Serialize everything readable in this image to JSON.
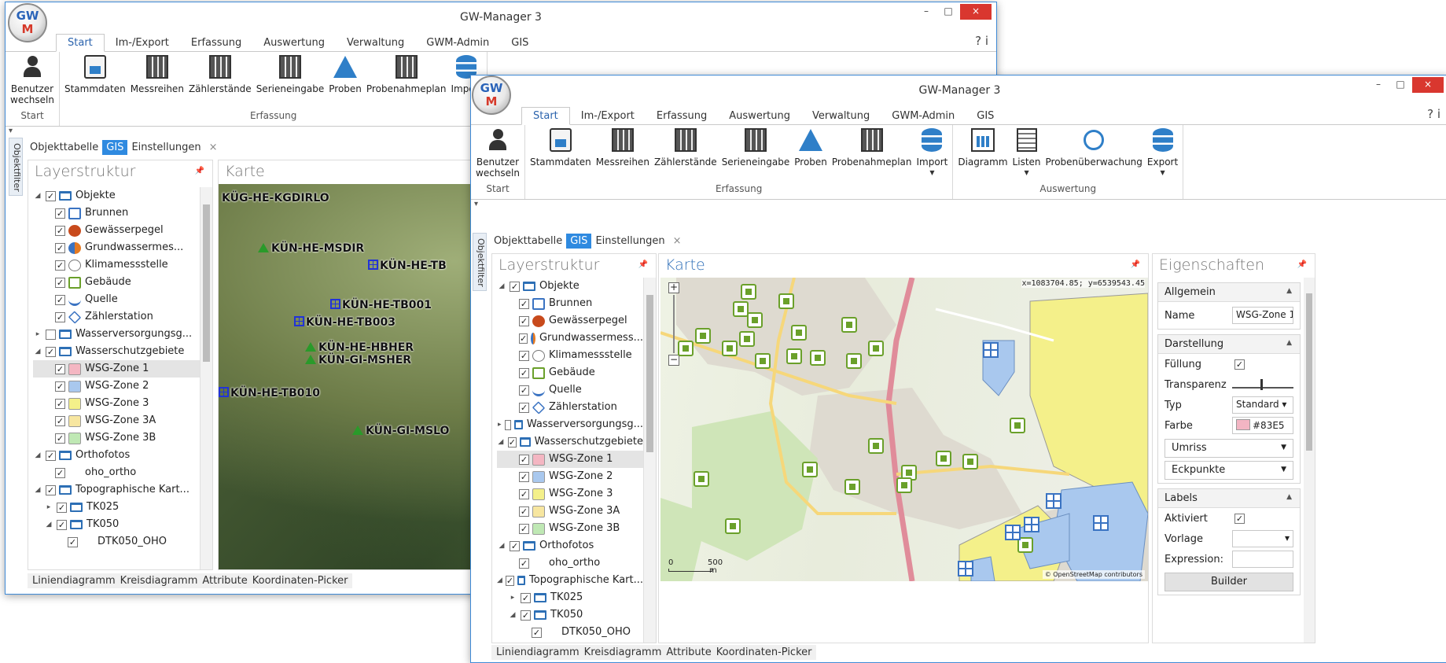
{
  "app_title": "GW-Manager 3",
  "logo": {
    "line1": "GW",
    "line2": "M"
  },
  "window_controls": {
    "min": "–",
    "max": "□",
    "close": "×"
  },
  "help_icons": "?  i",
  "menu_tabs": [
    "Start",
    "Im-/Export",
    "Erfassung",
    "Auswertung",
    "Verwaltung",
    "GWM-Admin",
    "GIS"
  ],
  "ribbon": {
    "start_group": "Start",
    "user_label_1": "Benutzer",
    "user_label_2": "wechseln",
    "erfassung_group": "Erfassung",
    "erfassung_items": [
      "Stammdaten",
      "Messreihen",
      "Zählerstände",
      "Serieneingabe",
      "Proben",
      "Probenahmeplan",
      "Import"
    ],
    "auswertung_group": "Auswertung",
    "auswertung_items": [
      "Diagramm",
      "Listen",
      "Probenüberwachung",
      "Export"
    ]
  },
  "objektfilter": "Objektfilter",
  "doc_tabs": [
    "Objekttabelle",
    "GIS",
    "Einstellungen"
  ],
  "layer_panel_title": "Layerstruktur",
  "map_panel_title": "Karte",
  "props_panel_title": "Eigenschaften",
  "layers": {
    "objekte": "Objekte",
    "brunnen": "Brunnen",
    "gewaesserpegel": "Gewässerpegel",
    "grundwasser_1": "Grundwassermes...",
    "grundwasser_2": "Grundwassermess...",
    "klimamessstelle": "Klimamessstelle",
    "gebaeude": "Gebäude",
    "quelle": "Quelle",
    "zaehlerstation": "Zählerstation",
    "wasserversorgung_1": "Wasserversorgungsg...",
    "wasserversorgung_2": "Wasserversorgungsg...",
    "wasserschutz": "Wasserschutzgebiete",
    "wsg1": "WSG-Zone 1",
    "wsg2": "WSG-Zone 2",
    "wsg3": "WSG-Zone 3",
    "wsg3a": "WSG-Zone 3A",
    "wsg3b": "WSG-Zone 3B",
    "orthofotos": "Orthofotos",
    "oho_ortho": "oho_ortho",
    "topo": "Topographische Kart...",
    "tk025": "TK025",
    "tk050": "TK050",
    "dtk050": "DTK050_OHO"
  },
  "map1_labels": [
    "KÜG-HE-KGDIRLO",
    "KÜN-HE-MSDIR",
    "KÜN-HE-TB",
    "KÜN-HE-TB001",
    "KÜN-HE-TB003",
    "KÜN-HE-HBHER",
    "KÜN-GI-MSHER",
    "KÜN-HE-TB010",
    "KÜN-GI-MSLO"
  ],
  "map2": {
    "coords": "x=1083704.85; y=6539543.45",
    "scale_0": "0",
    "scale_500": "500",
    "scale_unit": "m",
    "attribution": "© OpenStreetMap contributors",
    "zoom_plus": "+",
    "zoom_minus": "−"
  },
  "bottom_tabs": [
    "Liniendiagramm",
    "Kreisdiagramm",
    "Attribute",
    "Koordinaten-Picker"
  ],
  "properties": {
    "allgemein": "Allgemein",
    "name_label": "Name",
    "name_value": "WSG-Zone 1",
    "darstellung": "Darstellung",
    "fuellung": "Füllung",
    "transparenz": "Transparenz",
    "typ": "Typ",
    "typ_value": "Standard",
    "farbe": "Farbe",
    "farbe_value": "#83E5",
    "umriss": "Umriss",
    "eckpunkte": "Eckpunkte",
    "labels": "Labels",
    "aktiviert": "Aktiviert",
    "vorlage": "Vorlage",
    "expression": "Expression:",
    "builder": "Builder"
  },
  "colors": {
    "accent": "#2f8ae0",
    "wsg1": "#f4b6c2",
    "wsg2": "#a9c8ee",
    "wsg3": "#f4f08a",
    "wsg3a": "#f7e6a0",
    "wsg3b": "#bfe8b4",
    "house_green": "#6aa02a"
  }
}
